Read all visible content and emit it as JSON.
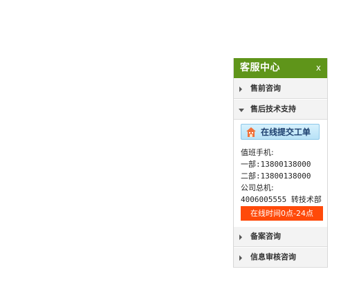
{
  "widget": {
    "title": "客服中心",
    "close_label": "x",
    "sections": [
      {
        "label": "售前咨询",
        "expanded": false
      },
      {
        "label": "售后技术支持",
        "expanded": true
      },
      {
        "label": "备案咨询",
        "expanded": false
      },
      {
        "label": "信息审核咨询",
        "expanded": false
      }
    ],
    "support_panel": {
      "submit_button": "在线提交工单",
      "duty_mobile_label": "值班手机:",
      "dept1": "一部:13800138000",
      "dept2": "二部:13800138000",
      "hotline_label": "公司总机:",
      "hotline_value": "4006005555 转技术部",
      "hours": "在线时间0点-24点"
    }
  },
  "colors": {
    "header_bg": "#5f951a",
    "hours_bg": "#ff4a0a",
    "button_bg": "#c7e9fa"
  },
  "icons": {
    "submit": "house-icon"
  }
}
